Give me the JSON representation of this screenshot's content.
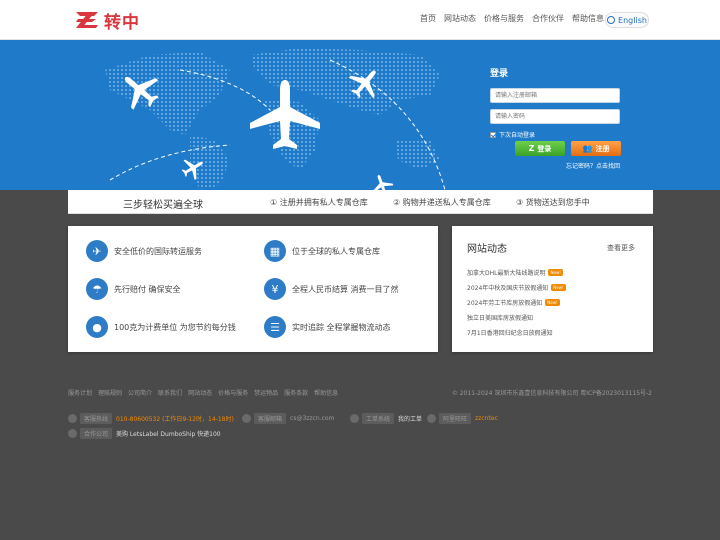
{
  "header": {
    "logo_text": "转中",
    "nav": [
      "首页",
      "网站动态",
      "价格与服务",
      "合作伙伴",
      "帮助信息"
    ],
    "lang_label": "English"
  },
  "login": {
    "title": "登录",
    "email_placeholder": "请输入注册邮箱",
    "password_placeholder": "请输入密码",
    "remember_label": "下次自动登录",
    "login_button": "登录",
    "register_button": "注册",
    "forgot": "忘记密码？点击找回"
  },
  "steps": {
    "head": "三步轻松买遍全球",
    "items": [
      "① 注册并拥有私人专属仓库",
      "② 购物并递送私人专属仓库",
      "③ 货物送达到您手中"
    ]
  },
  "features": [
    {
      "icon": "plane-icon",
      "text": "安全低价的国际转运服务"
    },
    {
      "icon": "warehouse-icon",
      "text": "位于全球的私人专属仓库"
    },
    {
      "icon": "umbrella-icon",
      "text": "先行赔付 确保安全"
    },
    {
      "icon": "rmb-icon",
      "text": "全程人民币结算 消费一目了然"
    },
    {
      "icon": "piggy-bank-icon",
      "text": "100克为计费单位 为您节约每分钱"
    },
    {
      "icon": "tracking-icon",
      "text": "实时追踪 全程掌握物流动态"
    }
  ],
  "news": {
    "title": "网站动态",
    "more": "查看更多",
    "items": [
      {
        "text": "加拿大DHL最新大陆线路说明",
        "badge": "New!"
      },
      {
        "text": "2024年中秋及国庆节放假通知",
        "badge": "New!"
      },
      {
        "text": "2024年劳工节库房放假通知",
        "badge": "New!"
      },
      {
        "text": "独立日美国库房放假通知",
        "badge": ""
      },
      {
        "text": "7月1日香港回归纪念日放假通知",
        "badge": ""
      }
    ]
  },
  "footer": {
    "links": [
      "服务计划",
      "理赔规则",
      "公司简介",
      "联系我们",
      "网站动态",
      "价格与服务",
      "禁运物品",
      "服务条款",
      "帮助信息"
    ],
    "copyright": "© 2011-2024 深圳市乐鑫壹信息科技有限公司 粤ICP备2023013115号-2",
    "hotline_label": "客服热线",
    "hotline_value": "010-80600532 (工作日9-12时，14-18时)",
    "email_label": "客服邮箱",
    "email_value": "cs@3zzcn.com",
    "ticket_label": "工单系统",
    "ticket_value": "我的工单",
    "wangwang_label": "阿里旺旺",
    "wangwang_value": "zzcntec",
    "partners_label": "合作公司",
    "partners_value": "美购  LetsLabel  DumboShip  快递100"
  },
  "colors": {
    "brand_blue": "#1f7bc9",
    "accent_orange": "#f08a00",
    "brand_red": "#d9363e"
  }
}
